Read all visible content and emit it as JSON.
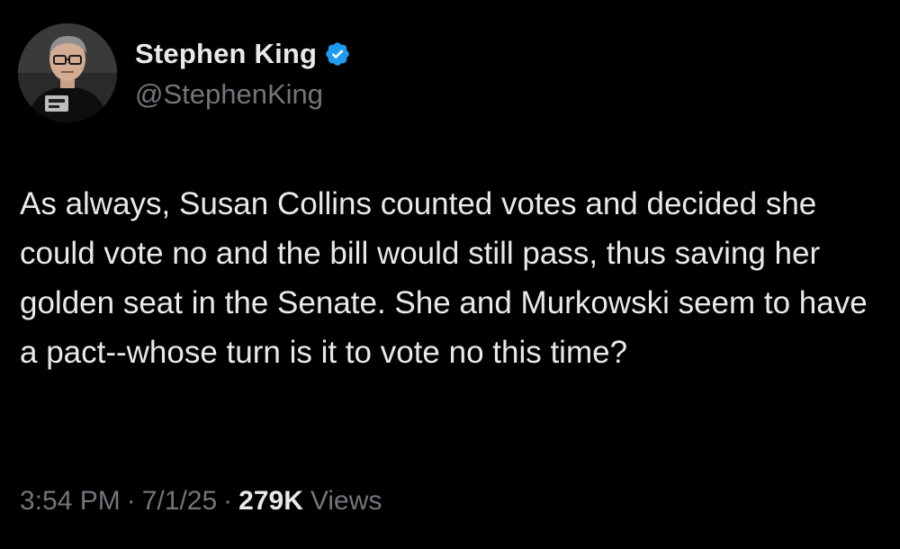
{
  "tweet": {
    "author": {
      "display_name": "Stephen King",
      "handle": "@StephenKing",
      "verified": true,
      "verified_icon": "verified-badge-icon",
      "avatar": "profile-photo"
    },
    "text": "As always, Susan Collins counted votes and decided she could vote no and the bill would still pass, thus saving her golden seat in the Senate. She and Murkowski seem to have a pact--whose turn is it to vote no this time?",
    "time": "3:54 PM",
    "separator": "·",
    "date": "7/1/25",
    "views_count": "279K",
    "views_label": "Views"
  },
  "colors": {
    "background": "#000000",
    "primary_text": "#e7e9ea",
    "secondary_text": "#71767b",
    "verified_blue": "#1d9bf0"
  }
}
